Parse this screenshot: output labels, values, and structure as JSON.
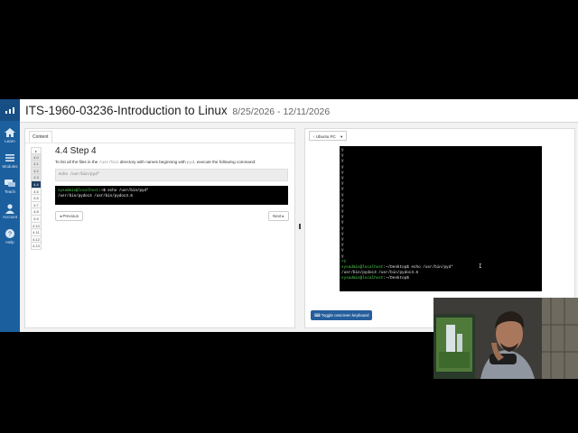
{
  "rail": {
    "items": [
      {
        "label": "Learn",
        "icon": "home-icon"
      },
      {
        "label": "Modules",
        "icon": "list-icon"
      },
      {
        "label": "Teach",
        "icon": "chat-icon"
      },
      {
        "label": "Account",
        "icon": "user-icon"
      },
      {
        "label": "Help",
        "icon": "help-icon"
      }
    ]
  },
  "header": {
    "title": "ITS-1960-03236-Introduction to Linux",
    "dates": "8/25/2026 - 12/11/2026"
  },
  "content": {
    "tab_label": "Content",
    "steps": [
      "▸",
      "4.0",
      "4.1",
      "4.2",
      "4.3",
      "4.4",
      "4.5",
      "4.6",
      "4.7",
      "4.8",
      "4.9",
      "4.10",
      "4.11",
      "4.12",
      "4.13"
    ],
    "active_step": "4.4",
    "lesson_title": "4.4 Step 4",
    "text_a": "To list all the files in the ",
    "text_code1": "/usr/bin",
    "text_b": " directory with names beginning with ",
    "text_code2": "pyd",
    "text_c": ", execute the following command:",
    "command": "echo /usr/bin/pyd*",
    "sample_prompt": "sysadmin@localhost",
    "sample_cmd": ":~$ echo /usr/bin/pyd*",
    "sample_output": "/usr/bin/pydoc3 /usr/bin/pydoc3.6",
    "prev_label": "◂ Previous",
    "next_label": "Next ▸"
  },
  "vm": {
    "tab_label": "‹ Ubuntu PC",
    "tab_caret": "▾",
    "y_lines": [
      "y",
      "y",
      "y",
      "y",
      "y",
      "y",
      "y",
      "y",
      "y",
      "y",
      "y",
      "y",
      "y",
      "y",
      "y",
      "y",
      "y",
      "y",
      "y",
      "y"
    ],
    "ctrl_c": "^C",
    "prompt1": "sysadmin@localhost",
    "cmd1": ":~/Desktop$ echo /usr/bin/pyd*",
    "output1": "/usr/bin/pydoc3 /usr/bin/pydoc3.6",
    "prompt2": "sysadmin@localhost",
    "cmd2": ":~/Desktop$",
    "keyboard_button": "⌨ Toggle onscreen keyboard"
  },
  "colors": {
    "rail": "#1b5f9e",
    "active_step": "#1e3d63",
    "prompt_green": "#4fd34f",
    "keyboard_button": "#245e9c"
  }
}
